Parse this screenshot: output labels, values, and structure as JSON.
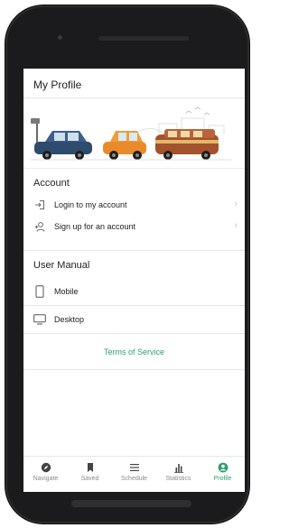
{
  "header": {
    "title": "My Profile"
  },
  "account": {
    "title": "Account",
    "items": [
      {
        "label": "Login to my account",
        "icon": "login-icon"
      },
      {
        "label": "Sign up for an account",
        "icon": "add-user-icon"
      }
    ]
  },
  "manual": {
    "title": "User Manual",
    "items": [
      {
        "label": "Mobile",
        "icon": "mobile-icon"
      },
      {
        "label": "Desktop",
        "icon": "desktop-icon"
      }
    ]
  },
  "tos": {
    "label": "Terms of Service"
  },
  "tabs": [
    {
      "label": "Navigate",
      "icon": "compass-icon"
    },
    {
      "label": "Saved",
      "icon": "bookmark-icon"
    },
    {
      "label": "Schedule",
      "icon": "list-icon"
    },
    {
      "label": "Statistics",
      "icon": "bar-chart-icon"
    },
    {
      "label": "Profile",
      "icon": "profile-icon"
    }
  ],
  "colors": {
    "accent": "#2e9e6e"
  }
}
